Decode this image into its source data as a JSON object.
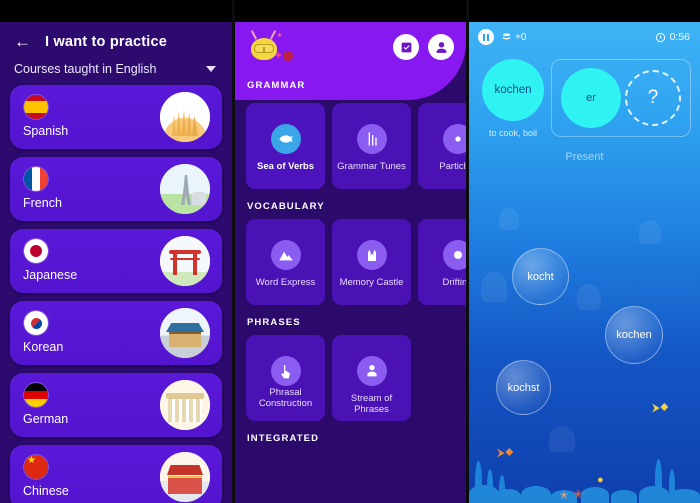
{
  "panel_courses": {
    "header": {
      "back_icon": "back-arrow-icon",
      "title": "I want to practice"
    },
    "filter": {
      "label": "Courses taught in English",
      "caret_icon": "chevron-down-icon"
    },
    "courses": [
      {
        "name": "Spanish",
        "flag": "flag-spain",
        "landmark": "sagrada-familia"
      },
      {
        "name": "French",
        "flag": "flag-france",
        "landmark": "eiffel-tower"
      },
      {
        "name": "Japanese",
        "flag": "flag-japan",
        "landmark": "torii-gate"
      },
      {
        "name": "Korean",
        "flag": "flag-south-korea",
        "landmark": "gyeongbokgung"
      },
      {
        "name": "German",
        "flag": "flag-germany",
        "landmark": "brandenburg-gate"
      },
      {
        "name": "Chinese",
        "flag": "flag-china",
        "landmark": "tiananmen"
      }
    ]
  },
  "panel_games": {
    "hero": {
      "mascot_icon": "giraffe-mascot-icon",
      "checklist_button_icon": "checklist-icon",
      "profile_button_icon": "profile-icon"
    },
    "sections": [
      {
        "title": "GRAMMAR",
        "tiles": [
          {
            "label": "Sea of Verbs",
            "icon": "fish-icon",
            "active": true
          },
          {
            "label": "Grammar Tunes",
            "icon": "tuning-icon",
            "active": false
          },
          {
            "label": "Particles",
            "icon": "atom-icon",
            "active": false
          }
        ]
      },
      {
        "title": "VOCABULARY",
        "tiles": [
          {
            "label": "Word Express",
            "icon": "mountain-icon",
            "active": false
          },
          {
            "label": "Memory Castle",
            "icon": "castle-icon",
            "active": false
          },
          {
            "label": "Drifting",
            "icon": "circle-icon",
            "active": false
          }
        ]
      },
      {
        "title": "PHRASES",
        "tiles": [
          {
            "label": "Phrasal Construction",
            "icon": "hand-pointer-icon",
            "active": false
          },
          {
            "label": "Stream of Phrases",
            "icon": "person-icon",
            "active": false
          }
        ]
      },
      {
        "title": "INTEGRATED",
        "tiles": []
      }
    ]
  },
  "panel_game": {
    "topbar": {
      "pause_icon": "pause-icon",
      "coin_icon": "coin-stack-icon",
      "score": "+0",
      "timer_icon": "clock-icon",
      "time": "0:56"
    },
    "prompt": {
      "word": "kochen",
      "translation": "to cook, boil",
      "pronoun": "er",
      "blank": "?",
      "tense": "Present"
    },
    "answer_bubbles": [
      {
        "label": "kocht"
      },
      {
        "label": "kochen"
      },
      {
        "label": "kochst"
      }
    ]
  }
}
